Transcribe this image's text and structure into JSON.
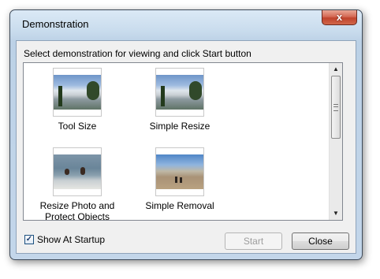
{
  "window": {
    "title": "Demonstration",
    "close_glyph": "x"
  },
  "instruction": "Select demonstration for viewing and click Start button",
  "demos": [
    {
      "label": "Tool Size",
      "thumbnail": "mountain-lake-photo"
    },
    {
      "label": "Simple Resize",
      "thumbnail": "mountain-lake-photo"
    },
    {
      "label": "Resize Photo and Protect Objects",
      "thumbnail": "swimmers-beach-photo"
    },
    {
      "label": "Simple Removal",
      "thumbnail": "desert-hikers-photo"
    }
  ],
  "scrollbar": {
    "up_glyph": "▲",
    "down_glyph": "▼"
  },
  "show_at_startup": {
    "label": "Show At Startup",
    "checked": true,
    "check_glyph": "✓"
  },
  "buttons": {
    "start_label": "Start",
    "start_enabled": false,
    "close_label": "Close"
  }
}
